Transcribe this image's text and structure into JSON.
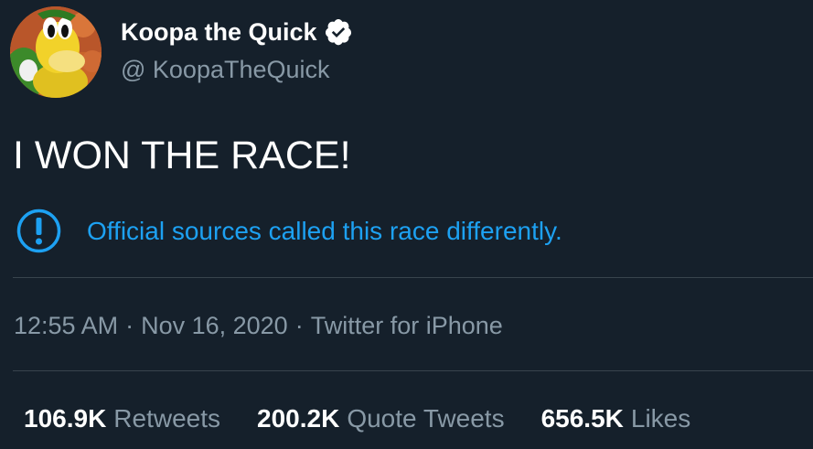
{
  "tweet": {
    "author": {
      "display_name": "Koopa the Quick",
      "handle": "@ KoopaTheQuick",
      "verified_icon": "verified-badge-icon",
      "avatar_icon": "koopa-avatar"
    },
    "text": "I WON THE RACE!",
    "notice": {
      "icon": "exclamation-circle-icon",
      "text": "Official sources called this race differently."
    },
    "meta": {
      "time": "12:55 AM",
      "separator": "·",
      "date": "Nov 16, 2020",
      "source": "Twitter for iPhone"
    },
    "stats": [
      {
        "count": "106.9K",
        "label": "Retweets"
      },
      {
        "count": "200.2K",
        "label": "Quote Tweets"
      },
      {
        "count": "656.5K",
        "label": "Likes"
      }
    ]
  },
  "colors": {
    "background": "#15202b",
    "primary_text": "#ffffff",
    "secondary_text": "#8899a6",
    "accent": "#1da1f2",
    "divider": "#38444d"
  }
}
